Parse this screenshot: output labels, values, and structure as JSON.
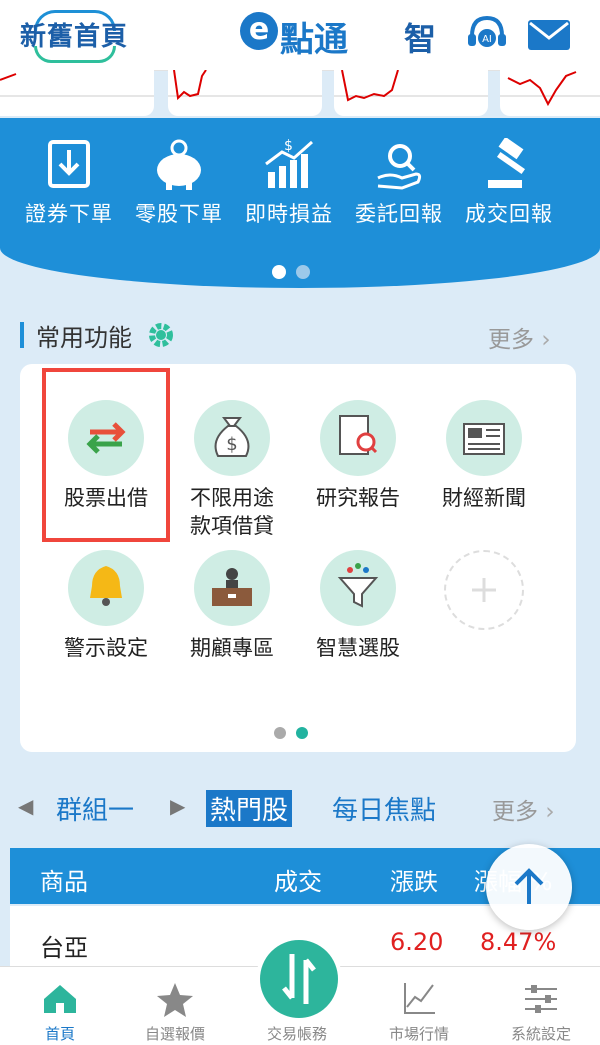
{
  "header": {
    "left_logo": "新舊首頁",
    "brand_e": "e",
    "brand_text": "點通",
    "smart_label": "智",
    "icons": [
      "ai-service-icon",
      "mail-icon"
    ]
  },
  "quick_actions": [
    {
      "label": "證券下單",
      "icon": "download-order-icon"
    },
    {
      "label": "零股下單",
      "icon": "piggy-bank-icon"
    },
    {
      "label": "即時損益",
      "icon": "profit-chart-icon"
    },
    {
      "label": "委託回報",
      "icon": "search-hand-icon"
    },
    {
      "label": "成交回報",
      "icon": "gavel-icon"
    }
  ],
  "common": {
    "title": "常用功能",
    "more": "更多",
    "tiles": [
      {
        "label": "股票出借",
        "icon": "exchange-arrows-icon"
      },
      {
        "label": "不限用途款項借貸",
        "line1": "不限用途",
        "line2": "款項借貸",
        "icon": "money-bag-icon"
      },
      {
        "label": "研究報告",
        "icon": "report-search-icon"
      },
      {
        "label": "財經新聞",
        "icon": "newspaper-icon"
      },
      {
        "label": "警示設定",
        "icon": "bell-icon"
      },
      {
        "label": "期顧專區",
        "icon": "advisor-desk-icon"
      },
      {
        "label": "智慧選股",
        "icon": "funnel-icon"
      }
    ]
  },
  "market_tabs": {
    "group": "群組一",
    "active": "熱門股",
    "daily": "每日焦點",
    "more": "更多"
  },
  "table": {
    "headers": [
      "商品",
      "成交",
      "漲跌",
      "漲幅 %"
    ],
    "rows": [
      {
        "name": "台亞",
        "price": "",
        "change": "6.20",
        "pct": "8.47%"
      }
    ]
  },
  "bottom_nav": [
    {
      "label": "首頁",
      "icon": "home-icon"
    },
    {
      "label": "自選報價",
      "icon": "star-icon"
    },
    {
      "label": "交易帳務",
      "icon": "trade-arrows-icon"
    },
    {
      "label": "市場行情",
      "icon": "market-chart-icon"
    },
    {
      "label": "系統設定",
      "icon": "sliders-icon"
    }
  ],
  "colors": {
    "primary": "#1e8fd8",
    "accent": "#2db59c",
    "highlight": "#f0463c",
    "up": "#e02020"
  }
}
